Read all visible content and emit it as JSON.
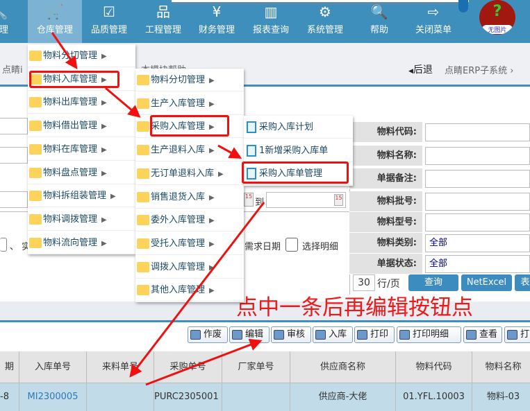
{
  "nav": {
    "items": [
      {
        "label": "管理",
        "icon": "wrench-icon",
        "glyph": "🔧"
      },
      {
        "label": "仓库管理",
        "icon": "cart-icon",
        "glyph": "🛒"
      },
      {
        "label": "品质管理",
        "icon": "checkbox-icon",
        "glyph": "☑"
      },
      {
        "label": "工程管理",
        "icon": "org-chart-icon",
        "glyph": "品"
      },
      {
        "label": "财务管理",
        "icon": "yen-icon",
        "glyph": "¥"
      },
      {
        "label": "报表查询",
        "icon": "bar-chart-icon",
        "glyph": "▥"
      },
      {
        "label": "系统管理",
        "icon": "gear-icon",
        "glyph": "⚙"
      },
      {
        "label": "帮助",
        "icon": "search-icon",
        "glyph": "🔍"
      },
      {
        "label": "关闭菜单",
        "icon": "exit-icon",
        "glyph": "⇨"
      }
    ],
    "avatar": {
      "glyph": "?",
      "caption": "无图片"
    }
  },
  "breadcrumb": {
    "left": "点睛i",
    "help": "本模块帮助",
    "back": "后退",
    "system": "点睛ERP子系统"
  },
  "menu1": [
    "物料分切管理",
    "物料入库管理",
    "物料出库管理",
    "物料借出管理",
    "物料在库管理",
    "物料盘点管理",
    "物料拆组装管理",
    "物料调拨管理",
    "物料流向管理"
  ],
  "menu2": [
    "物料分切管理",
    "生产入库管理",
    "采购入库管理",
    "生产退料入库",
    "无订单退料入库",
    "销售退货入库",
    "委外入库管理",
    "受托入库管理",
    "调拨入库管理",
    "其他入库管理"
  ],
  "menu3": [
    "采购入库计划",
    "1新增采购入库单",
    "采购入库单管理"
  ],
  "form": {
    "labels": [
      "物料代码:",
      "物料名称:",
      "单据备注:",
      "物料批号:",
      "物料型号:",
      "物料类别:",
      "单据状态:"
    ],
    "values": [
      "",
      "",
      "",
      "",
      "",
      "全部",
      "全部"
    ],
    "to": "到",
    "need_date": "需求日期",
    "select_detail": "选择明细",
    "sep": "、 实",
    "page_size": "30",
    "per_page": "行/页",
    "query": "查询",
    "excel": "NetExcel",
    "more": "表"
  },
  "annotation": "点中一条后再编辑按钮点",
  "toolbar": [
    "作废",
    "编辑",
    "审核",
    "入库",
    "打印",
    "打印明细",
    "查看",
    "打"
  ],
  "table": {
    "headers": [
      "期",
      "入库单号",
      "来料单号",
      "采购单号",
      "厂家单号",
      "供应商名称",
      "物料代码",
      "物料名称"
    ],
    "rows": [
      [
        "-8",
        "MI2300005",
        "",
        "PURC2305001",
        "",
        "供应商-大佬",
        "01.YFL.10003",
        "物料-03"
      ]
    ]
  },
  "colors": {
    "nav": "#3f8fbd",
    "annotation": "#f01010",
    "row": "#c2dbe8"
  }
}
